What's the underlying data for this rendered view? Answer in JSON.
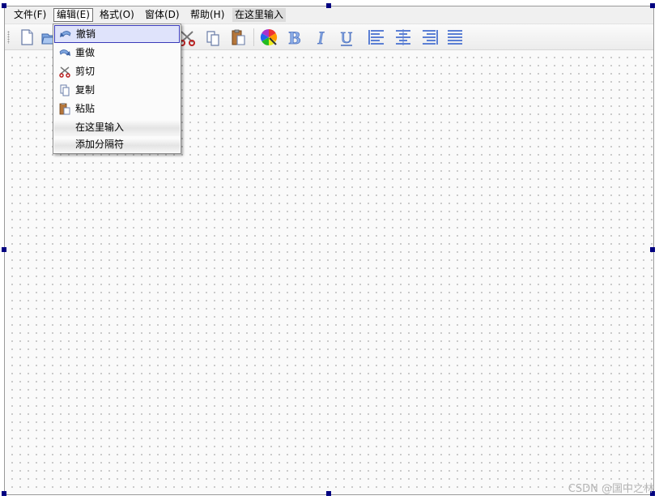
{
  "menubar": {
    "items": [
      {
        "label": "文件(F)"
      },
      {
        "label": "编辑(E)"
      },
      {
        "label": "格式(O)"
      },
      {
        "label": "窗体(D)"
      },
      {
        "label": "帮助(H)"
      },
      {
        "label": "在这里输入"
      }
    ]
  },
  "toolbar": {
    "buttons": [
      {
        "icon": "new-document-icon"
      },
      {
        "icon": "open-folder-icon"
      },
      {
        "icon": "cut-icon"
      },
      {
        "icon": "copy-icon"
      },
      {
        "icon": "paste-icon"
      },
      {
        "icon": "color-icon"
      },
      {
        "icon": "bold-icon",
        "glyph": "B"
      },
      {
        "icon": "italic-icon",
        "glyph": "I"
      },
      {
        "icon": "underline-icon",
        "glyph": "U"
      },
      {
        "icon": "align-left-icon"
      },
      {
        "icon": "align-center-icon"
      },
      {
        "icon": "align-right-icon"
      },
      {
        "icon": "align-justify-icon"
      }
    ]
  },
  "edit_menu": {
    "items": [
      {
        "label": "撤销",
        "icon": "undo-icon"
      },
      {
        "label": "重做",
        "icon": "redo-icon"
      },
      {
        "label": "剪切",
        "icon": "cut-icon"
      },
      {
        "label": "复制",
        "icon": "copy-icon"
      },
      {
        "label": "粘贴",
        "icon": "paste-icon"
      },
      {
        "label": "在这里输入"
      },
      {
        "label": "添加分隔符"
      }
    ]
  },
  "watermark": "CSDN @国中之林",
  "colors": {
    "selection_handle": "#000080",
    "menu_highlight": "#dfe3fb",
    "menu_highlight_border": "#3a3ab8",
    "icon_blue": "#5b7fd4"
  }
}
